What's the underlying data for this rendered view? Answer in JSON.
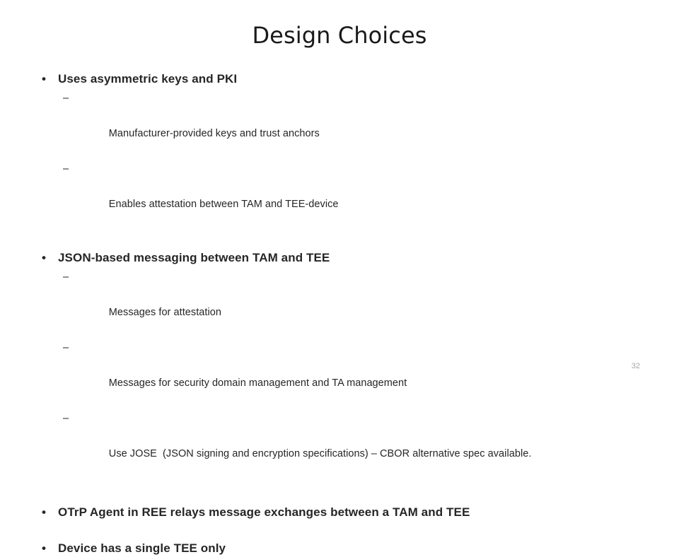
{
  "slide": {
    "title": "Design Choices",
    "page_number": "32",
    "bullet_marker": "•",
    "dash_marker": "–",
    "text_color": "#262626",
    "page_number_color": "#a6a6a6",
    "background_color": "#ffffff",
    "groups": [
      {
        "heading": "Uses asymmetric keys and PKI",
        "subs": [
          "Manufacturer-provided keys and trust anchors",
          "Enables attestation between TAM and TEE-device"
        ]
      },
      {
        "heading": "JSON-based messaging between TAM and TEE",
        "subs": [
          "Messages for attestation",
          "Messages for security domain management and TA management",
          "Use JOSE  (JSON signing and encryption specifications) – CBOR alternative spec available."
        ]
      },
      {
        "heading": "OTrP Agent in REE relays message exchanges between a TAM and TEE",
        "subs": []
      },
      {
        "heading": "Device has a single TEE only",
        "subs": []
      }
    ]
  }
}
